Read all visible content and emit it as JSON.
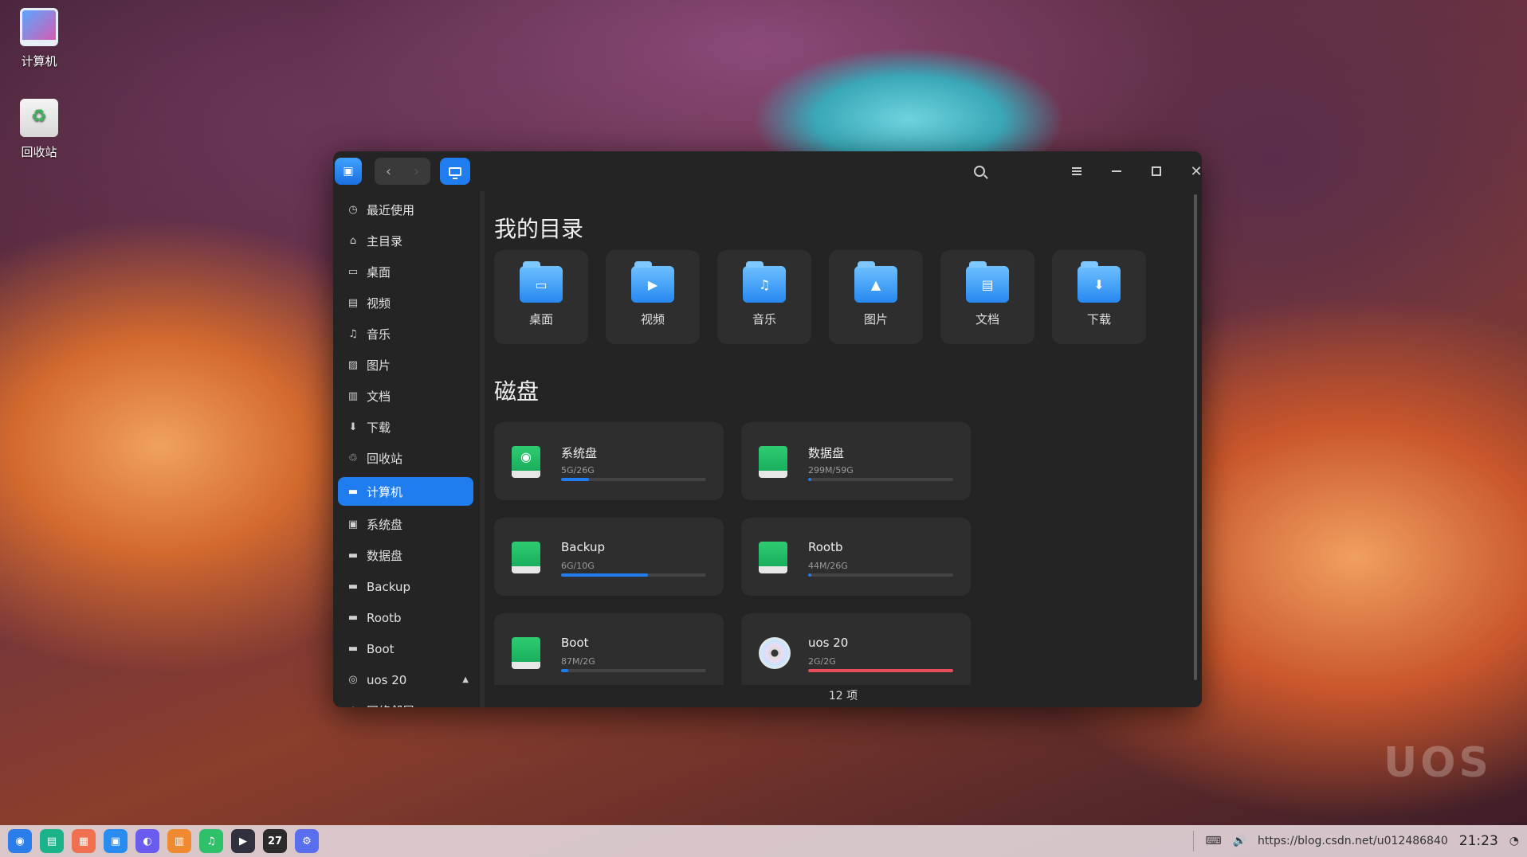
{
  "desktop": {
    "icons": [
      {
        "label": "计算机",
        "icon": "computer-icon"
      },
      {
        "label": "回收站",
        "icon": "trash-icon"
      }
    ],
    "watermark": "UOS"
  },
  "window": {
    "nav": {
      "back": "‹",
      "forward": "›"
    },
    "sidebar": {
      "items": [
        {
          "label": "最近使用",
          "icon": "clock-icon",
          "glyph": "◷"
        },
        {
          "label": "主目录",
          "icon": "home-icon",
          "glyph": "⌂"
        },
        {
          "label": "桌面",
          "icon": "desktop-icon",
          "glyph": "▭"
        },
        {
          "label": "视频",
          "icon": "video-icon",
          "glyph": "▤"
        },
        {
          "label": "音乐",
          "icon": "music-icon",
          "glyph": "♫"
        },
        {
          "label": "图片",
          "icon": "picture-icon",
          "glyph": "▨"
        },
        {
          "label": "文档",
          "icon": "document-icon",
          "glyph": "▥"
        },
        {
          "label": "下载",
          "icon": "download-icon",
          "glyph": "⬇"
        },
        {
          "label": "回收站",
          "icon": "trash-icon",
          "glyph": "♲"
        }
      ],
      "devices": [
        {
          "label": "计算机",
          "icon": "computer-icon",
          "glyph": "▬",
          "active": true
        },
        {
          "label": "系统盘",
          "icon": "disk-icon",
          "glyph": "▣"
        },
        {
          "label": "数据盘",
          "icon": "disk-icon",
          "glyph": "▬"
        },
        {
          "label": "Backup",
          "icon": "disk-icon",
          "glyph": "▬"
        },
        {
          "label": "Rootb",
          "icon": "disk-icon",
          "glyph": "▬"
        },
        {
          "label": "Boot",
          "icon": "disk-icon",
          "glyph": "▬"
        },
        {
          "label": "uos 20",
          "icon": "cdrom-icon",
          "glyph": "◎",
          "eject": "▲"
        },
        {
          "label": "网络邻居",
          "icon": "network-icon",
          "glyph": "◌"
        }
      ]
    },
    "main": {
      "my_dirs_title": "我的目录",
      "folders": [
        {
          "label": "桌面",
          "icon": "desktop-folder-icon",
          "glyph": "▭"
        },
        {
          "label": "视频",
          "icon": "video-folder-icon",
          "glyph": "▶"
        },
        {
          "label": "音乐",
          "icon": "music-folder-icon",
          "glyph": "♫"
        },
        {
          "label": "图片",
          "icon": "picture-folder-icon",
          "glyph": "▲"
        },
        {
          "label": "文档",
          "icon": "document-folder-icon",
          "glyph": "▤"
        },
        {
          "label": "下载",
          "icon": "download-folder-icon",
          "glyph": "⬇"
        }
      ],
      "disks_title": "磁盘",
      "disks": [
        {
          "name": "系统盘",
          "size": "5G/26G",
          "used_fraction": 0.19,
          "icon": "system-disk-icon",
          "kind": "sys"
        },
        {
          "name": "数据盘",
          "size": "299M/59G",
          "used_fraction": 0.005,
          "icon": "disk-icon",
          "kind": "disk"
        },
        {
          "name": "Backup",
          "size": "6G/10G",
          "used_fraction": 0.6,
          "icon": "disk-icon",
          "kind": "disk"
        },
        {
          "name": "Rootb",
          "size": "44M/26G",
          "used_fraction": 0.002,
          "icon": "disk-icon",
          "kind": "disk"
        },
        {
          "name": "Boot",
          "size": "87M/2G",
          "used_fraction": 0.05,
          "icon": "disk-icon",
          "kind": "disk"
        },
        {
          "name": "uos 20",
          "size": "2G/2G",
          "used_fraction": 1.0,
          "icon": "cdrom-icon",
          "kind": "cd"
        }
      ],
      "status": "12 项"
    }
  },
  "taskbar": {
    "apps": [
      {
        "name": "launcher-icon",
        "glyph": "◉",
        "color": "#2b7de9"
      },
      {
        "name": "multitask-view-icon",
        "glyph": "▤",
        "color": "#1bb38a"
      },
      {
        "name": "workspace-icon",
        "glyph": "▦",
        "color": "#f07050"
      },
      {
        "name": "file-manager-icon",
        "glyph": "▣",
        "color": "#2a8bf0"
      },
      {
        "name": "browser-icon",
        "glyph": "◐",
        "color": "#6b5cf0"
      },
      {
        "name": "app-store-icon",
        "glyph": "▥",
        "color": "#f08a30"
      },
      {
        "name": "music-player-icon",
        "glyph": "♫",
        "color": "#2fc06a"
      },
      {
        "name": "video-player-icon",
        "glyph": "▶",
        "color": "#303040"
      },
      {
        "name": "calendar-icon",
        "glyph": "27",
        "color": "#2b2b2b"
      },
      {
        "name": "settings-icon",
        "glyph": "⚙",
        "color": "#5a6ef0"
      }
    ],
    "tray_url": "https://blog.csdn.net/u012486840",
    "clock": "21:23"
  }
}
